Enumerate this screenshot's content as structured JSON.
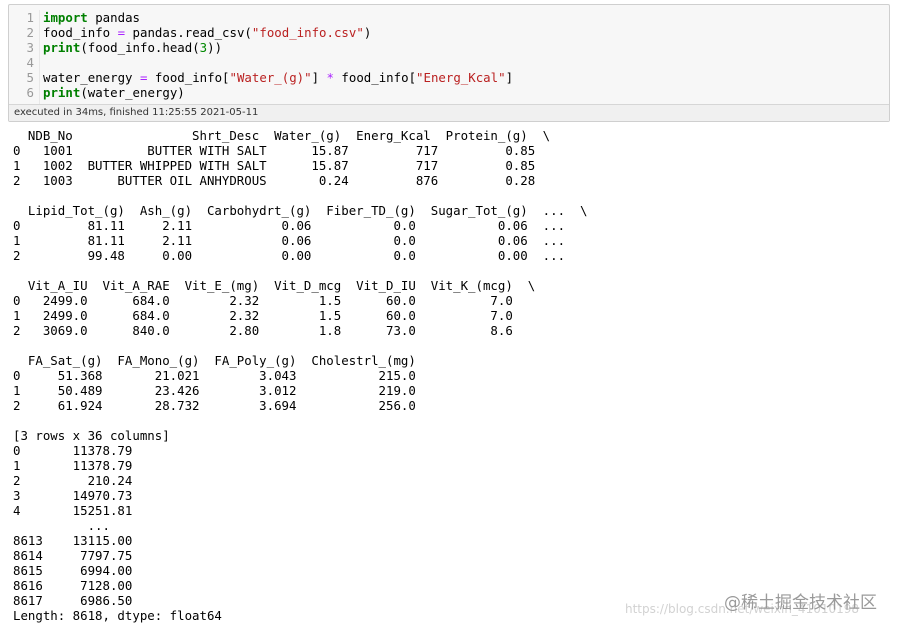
{
  "code_cell": {
    "lines": [
      {
        "num": "1",
        "parts": [
          {
            "t": "import",
            "c": "kw"
          },
          {
            "t": " pandas",
            "c": ""
          }
        ]
      },
      {
        "num": "2",
        "parts": [
          {
            "t": "food_info ",
            "c": ""
          },
          {
            "t": "=",
            "c": "op"
          },
          {
            "t": " pandas.read_csv(",
            "c": ""
          },
          {
            "t": "\"food_info.csv\"",
            "c": "str"
          },
          {
            "t": ")",
            "c": ""
          }
        ]
      },
      {
        "num": "3",
        "parts": [
          {
            "t": "print",
            "c": "kw"
          },
          {
            "t": "(food_info.head(",
            "c": ""
          },
          {
            "t": "3",
            "c": "num"
          },
          {
            "t": "))",
            "c": ""
          }
        ]
      },
      {
        "num": "4",
        "parts": []
      },
      {
        "num": "5",
        "parts": [
          {
            "t": "water_energy ",
            "c": ""
          },
          {
            "t": "=",
            "c": "op"
          },
          {
            "t": " food_info[",
            "c": ""
          },
          {
            "t": "\"Water_(g)\"",
            "c": "str"
          },
          {
            "t": "] ",
            "c": ""
          },
          {
            "t": "*",
            "c": "op"
          },
          {
            "t": " food_info[",
            "c": ""
          },
          {
            "t": "\"Energ_Kcal\"",
            "c": "str"
          },
          {
            "t": "]",
            "c": ""
          }
        ]
      },
      {
        "num": "6",
        "parts": [
          {
            "t": "print",
            "c": "kw"
          },
          {
            "t": "(water_energy)",
            "c": ""
          }
        ]
      }
    ],
    "status": "executed in 34ms, finished 11:25:55 2021-05-11"
  },
  "output": {
    "text": "  NDB_No                Shrt_Desc  Water_(g)  Energ_Kcal  Protein_(g)  \\\n0   1001          BUTTER WITH SALT      15.87         717         0.85\n1   1002  BUTTER WHIPPED WITH SALT      15.87         717         0.85\n2   1003      BUTTER OIL ANHYDROUS       0.24         876         0.28\n\n  Lipid_Tot_(g)  Ash_(g)  Carbohydrt_(g)  Fiber_TD_(g)  Sugar_Tot_(g)  ...  \\\n0         81.11     2.11            0.06           0.0           0.06  ...\n1         81.11     2.11            0.06           0.0           0.06  ...\n2         99.48     0.00            0.00           0.0           0.00  ...\n\n  Vit_A_IU  Vit_A_RAE  Vit_E_(mg)  Vit_D_mcg  Vit_D_IU  Vit_K_(mcg)  \\\n0   2499.0      684.0        2.32        1.5      60.0          7.0\n1   2499.0      684.0        2.32        1.5      60.0          7.0\n2   3069.0      840.0        2.80        1.8      73.0          8.6\n\n  FA_Sat_(g)  FA_Mono_(g)  FA_Poly_(g)  Cholestrl_(mg)\n0     51.368       21.021        3.043           215.0\n1     50.489       23.426        3.012           219.0\n2     61.924       28.732        3.694           256.0\n\n[3 rows x 36 columns]\n0       11378.79\n1       11378.79\n2         210.24\n3       14970.73\n4       15251.81\n          ...\n8613    13115.00\n8614     7797.75\n8615     6994.00\n8616     7128.00\n8617     6986.50\nLength: 8618, dtype: float64"
  },
  "watermark": {
    "url": "https://blog.csdn.net/weixin_41010198",
    "site": "@稀土掘金技术社区"
  }
}
